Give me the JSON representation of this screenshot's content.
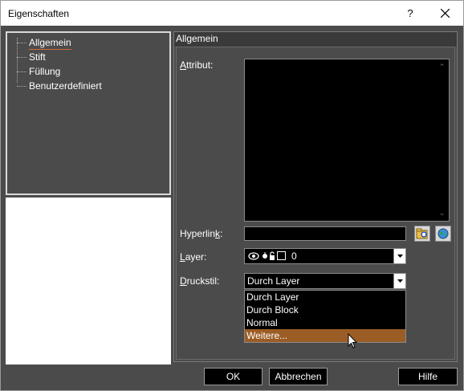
{
  "window": {
    "title": "Eigenschaften",
    "help_glyph": "?",
    "close_icon": "close-icon"
  },
  "tree": {
    "items": [
      {
        "label": "Allgemein",
        "selected": true
      },
      {
        "label": "Stift"
      },
      {
        "label": "Füllung"
      },
      {
        "label": "Benutzerdefiniert"
      }
    ]
  },
  "section": {
    "title": "Allgemein"
  },
  "fields": {
    "attribut_label": "ttribut:",
    "attribut_label_mnemonic": "A",
    "hyperlink_label_prefix": "Hyperlin",
    "hyperlink_label_mnemonic": "k",
    "hyperlink_label_suffix": ":",
    "layer_label": "ayer:",
    "layer_label_mnemonic": "L",
    "layer_value": "0",
    "druckstil_label": "ruckstil:",
    "druckstil_label_mnemonic": "D",
    "druckstil_value": "Durch Layer"
  },
  "druckstil_options": [
    {
      "label": "Durch Layer"
    },
    {
      "label": "Durch Block"
    },
    {
      "label": "Normal"
    },
    {
      "label": "Weitere...",
      "highlighted": true
    }
  ],
  "buttons": {
    "ok": "OK",
    "cancel": "Abbrechen",
    "help": "Hilfe"
  },
  "colors": {
    "panel_bg": "#4b4b4b",
    "highlight": "#9b5d25",
    "field_bg": "#000000"
  }
}
